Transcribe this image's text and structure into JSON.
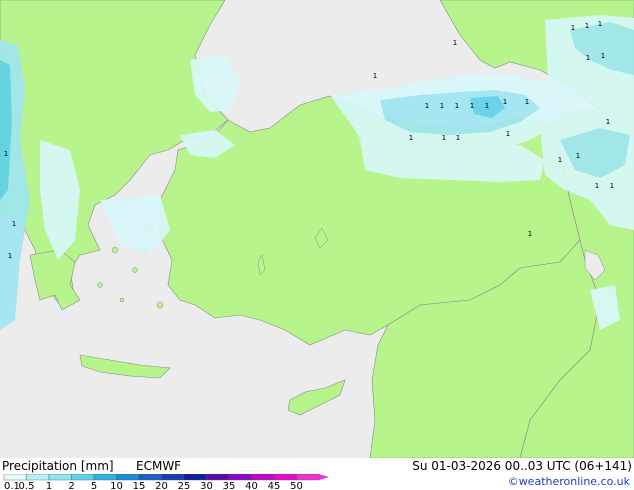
{
  "header": {
    "title": "Precipitation [mm]",
    "model": "ECMWF",
    "valid_time": "Su 01-03-2026 00..03 UTC (06+141)",
    "credit": "©weatheronline.co.uk"
  },
  "legend": {
    "values": [
      "0.1",
      "0.5",
      "1",
      "2",
      "5",
      "10",
      "15",
      "20",
      "25",
      "30",
      "35",
      "40",
      "45",
      "50"
    ],
    "colors": [
      "#e6fcfc",
      "#b8f2f8",
      "#8de4f2",
      "#5fd0ea",
      "#2eb4e4",
      "#1c8ed6",
      "#1a62c4",
      "#1a3cb0",
      "#10209a",
      "#5a0aa8",
      "#8c08c2",
      "#c00ac8",
      "#e40ec8",
      "#f032d4"
    ]
  },
  "colors": {
    "sea": "#ececec",
    "land": "#b8f48c",
    "coast": "#8a8a8a",
    "precip_light": "#d8f8fa",
    "precip_mid": "#9fe6f2",
    "precip_strong": "#5ed0ec"
  },
  "map": {
    "cell_values": [
      "1",
      "1",
      "1",
      "1",
      "1",
      "1",
      "1",
      "1",
      "1",
      "1",
      "1",
      "1",
      "1",
      "1",
      "1",
      "1",
      "1",
      "1",
      "1",
      "1",
      "1",
      "1",
      "1",
      "1",
      "1",
      "1",
      "1"
    ]
  }
}
